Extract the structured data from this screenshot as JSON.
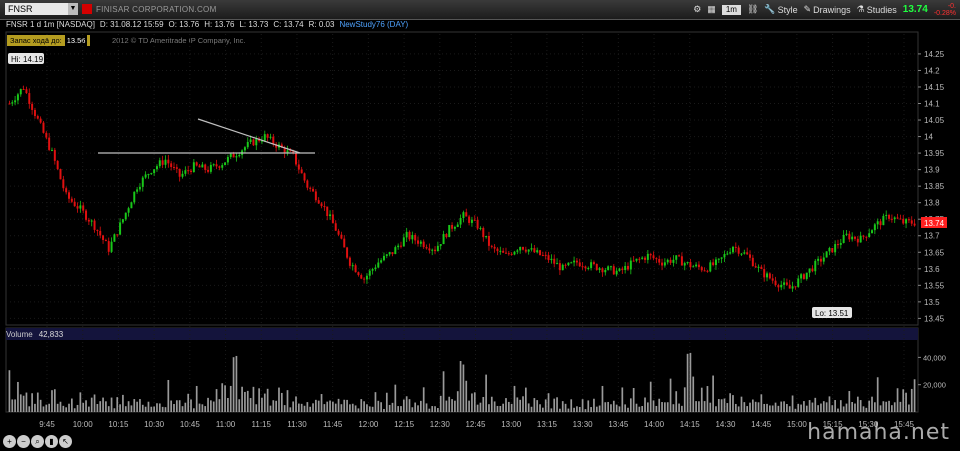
{
  "toolbar": {
    "symbol": "FNSR",
    "company": "FINISAR CORPORATION.COM",
    "timeframe": "1m",
    "style_label": "Style",
    "drawings_label": "Drawings",
    "studies_label": "Studies",
    "last_price": "13.74",
    "change_top": "-0.",
    "change_bottom": "-0.28%"
  },
  "info": {
    "title": "FNSR 1 d 1m [NASDAQ]",
    "date": "D: 31.08.12 15:59",
    "open": "O: 13.76",
    "high": "H: 13.76",
    "low": "L: 13.73",
    "close": "C: 13.74",
    "range": "R: 0.03",
    "study": "NewStudy76 (DAY)"
  },
  "margin_box": {
    "label": "Запас хода до:",
    "value": "13.56"
  },
  "copyright": "2012 © TD Ameritrade IP Company, Inc.",
  "volume": {
    "label": "Volume",
    "value": "42,833"
  },
  "watermark": "hamaha.net",
  "chart_data": {
    "type": "candlestick",
    "x_ticks": [
      "9:45",
      "10:00",
      "10:15",
      "10:30",
      "10:45",
      "11:00",
      "11:15",
      "11:30",
      "11:45",
      "12:00",
      "12:15",
      "12:30",
      "12:45",
      "13:00",
      "13:15",
      "13:30",
      "13:45",
      "14:00",
      "14:15",
      "14:30",
      "14:45",
      "15:00",
      "15:15",
      "15:30",
      "15:45"
    ],
    "y_ticks": [
      "14.25",
      "14.2",
      "14.15",
      "14.1",
      "14.05",
      "14",
      "13.95",
      "13.9",
      "13.85",
      "13.8",
      "13.75",
      "13.7",
      "13.65",
      "13.6",
      "13.55",
      "13.5",
      "13.45"
    ],
    "ylim": [
      13.43,
      14.28
    ],
    "volume_ticks": [
      "40,000",
      "20,000"
    ],
    "volume_ylim": [
      0,
      52000
    ],
    "hi_label": "Hi: 14.19",
    "lo_label": "Lo: 13.51",
    "last_label": "13.74",
    "up_color": "#19c819",
    "down_color": "#e01010",
    "price_path": [
      [
        0,
        14.1
      ],
      [
        5,
        14.15
      ],
      [
        10,
        14.05
      ],
      [
        15,
        13.95
      ],
      [
        20,
        13.82
      ],
      [
        25,
        13.78
      ],
      [
        30,
        13.73
      ],
      [
        35,
        13.66
      ],
      [
        40,
        13.75
      ],
      [
        45,
        13.85
      ],
      [
        50,
        13.9
      ],
      [
        55,
        13.93
      ],
      [
        60,
        13.88
      ],
      [
        65,
        13.91
      ],
      [
        70,
        13.9
      ],
      [
        75,
        13.92
      ],
      [
        80,
        13.95
      ],
      [
        85,
        13.98
      ],
      [
        90,
        14.0
      ],
      [
        95,
        13.97
      ],
      [
        100,
        13.94
      ],
      [
        105,
        13.85
      ],
      [
        110,
        13.8
      ],
      [
        115,
        13.72
      ],
      [
        120,
        13.62
      ],
      [
        125,
        13.57
      ],
      [
        130,
        13.62
      ],
      [
        135,
        13.65
      ],
      [
        140,
        13.7
      ],
      [
        145,
        13.68
      ],
      [
        150,
        13.66
      ],
      [
        155,
        13.72
      ],
      [
        160,
        13.76
      ],
      [
        165,
        13.73
      ],
      [
        170,
        13.66
      ],
      [
        175,
        13.64
      ],
      [
        180,
        13.67
      ],
      [
        185,
        13.65
      ],
      [
        190,
        13.63
      ],
      [
        195,
        13.6
      ],
      [
        200,
        13.62
      ],
      [
        205,
        13.61
      ],
      [
        210,
        13.6
      ],
      [
        215,
        13.59
      ],
      [
        220,
        13.62
      ],
      [
        225,
        13.64
      ],
      [
        230,
        13.62
      ],
      [
        235,
        13.63
      ],
      [
        240,
        13.61
      ],
      [
        245,
        13.6
      ],
      [
        250,
        13.62
      ],
      [
        255,
        13.67
      ],
      [
        260,
        13.64
      ],
      [
        265,
        13.59
      ],
      [
        270,
        13.56
      ],
      [
        275,
        13.54
      ],
      [
        280,
        13.58
      ],
      [
        285,
        13.62
      ],
      [
        290,
        13.66
      ],
      [
        295,
        13.7
      ],
      [
        300,
        13.69
      ],
      [
        305,
        13.73
      ],
      [
        310,
        13.76
      ],
      [
        315,
        13.74
      ],
      [
        319,
        13.74
      ]
    ],
    "volume_bars": [
      48000,
      30000,
      22000,
      25000,
      18000,
      15000,
      20000,
      12000,
      28000,
      14000,
      16000,
      18000,
      13000,
      10000,
      15000,
      24000,
      17000,
      12000,
      20000,
      11000,
      9000,
      14000,
      19000,
      8000,
      12000,
      16000,
      10000,
      13000,
      9000,
      11000,
      18000,
      7000,
      10000,
      12000,
      8000,
      9000,
      14000,
      6000,
      11000,
      9000,
      13000,
      8000,
      10000,
      7000,
      12000,
      9000,
      15000,
      8000,
      11000,
      20000,
      9000,
      12000,
      7000,
      16000,
      10000,
      8000,
      28000,
      11000,
      9000,
      13000,
      22000,
      10000,
      8000,
      14000,
      12000,
      9000,
      30000,
      11000,
      8000,
      10000,
      13000,
      9000,
      12000,
      45000,
      15000,
      25000,
      20000,
      14000,
      30000,
      50000
    ],
    "annotations": [
      "support-line",
      "resistance-triangle"
    ]
  }
}
